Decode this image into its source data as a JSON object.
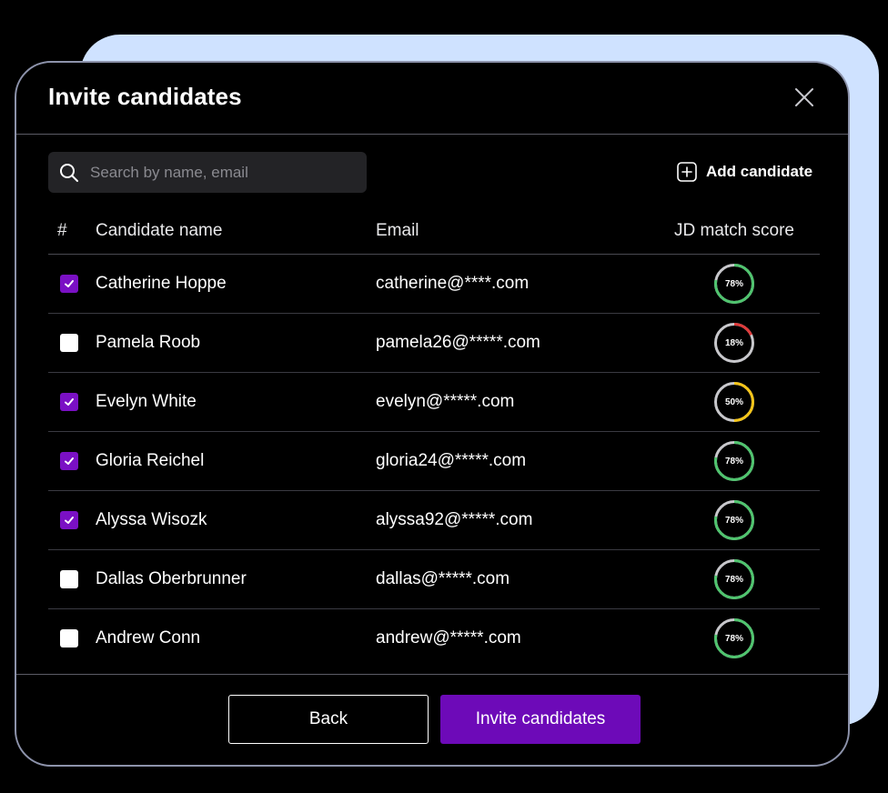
{
  "colors": {
    "accent": "#6d0ab8",
    "checkbox_on": "#7a10c4",
    "score_high": "#4fc46e",
    "score_mid": "#f5c518",
    "score_low": "#e03b3b",
    "ring_track": "#c8c8cc",
    "back_card": "#cfe2ff"
  },
  "modal": {
    "title": "Invite candidates",
    "close_icon": "close-icon"
  },
  "search": {
    "placeholder": "Search by name, email",
    "value": "",
    "icon": "search-icon"
  },
  "add_candidate": {
    "label": "Add candidate",
    "icon": "plus-square-icon"
  },
  "table": {
    "columns": {
      "index": "#",
      "name": "Candidate name",
      "email": "Email",
      "score": "JD match score"
    },
    "rows": [
      {
        "name": "Catherine Hoppe",
        "email": "catherine@****.com",
        "checked": true,
        "score": 78,
        "score_label": "78%"
      },
      {
        "name": "Pamela Roob",
        "email": "pamela26@*****.com",
        "checked": false,
        "score": 18,
        "score_label": "18%"
      },
      {
        "name": "Evelyn White",
        "email": "evelyn@*****.com",
        "checked": true,
        "score": 50,
        "score_label": "50%"
      },
      {
        "name": "Gloria Reichel",
        "email": "gloria24@*****.com",
        "checked": true,
        "score": 78,
        "score_label": "78%"
      },
      {
        "name": "Alyssa Wisozk",
        "email": "alyssa92@*****.com",
        "checked": true,
        "score": 78,
        "score_label": "78%"
      },
      {
        "name": "Dallas Oberbrunner",
        "email": "dallas@*****.com",
        "checked": false,
        "score": 78,
        "score_label": "78%"
      },
      {
        "name": "Andrew Conn",
        "email": "andrew@*****.com",
        "checked": false,
        "score": 78,
        "score_label": "78%"
      }
    ]
  },
  "footer": {
    "back_label": "Back",
    "invite_label": "Invite candidates"
  }
}
